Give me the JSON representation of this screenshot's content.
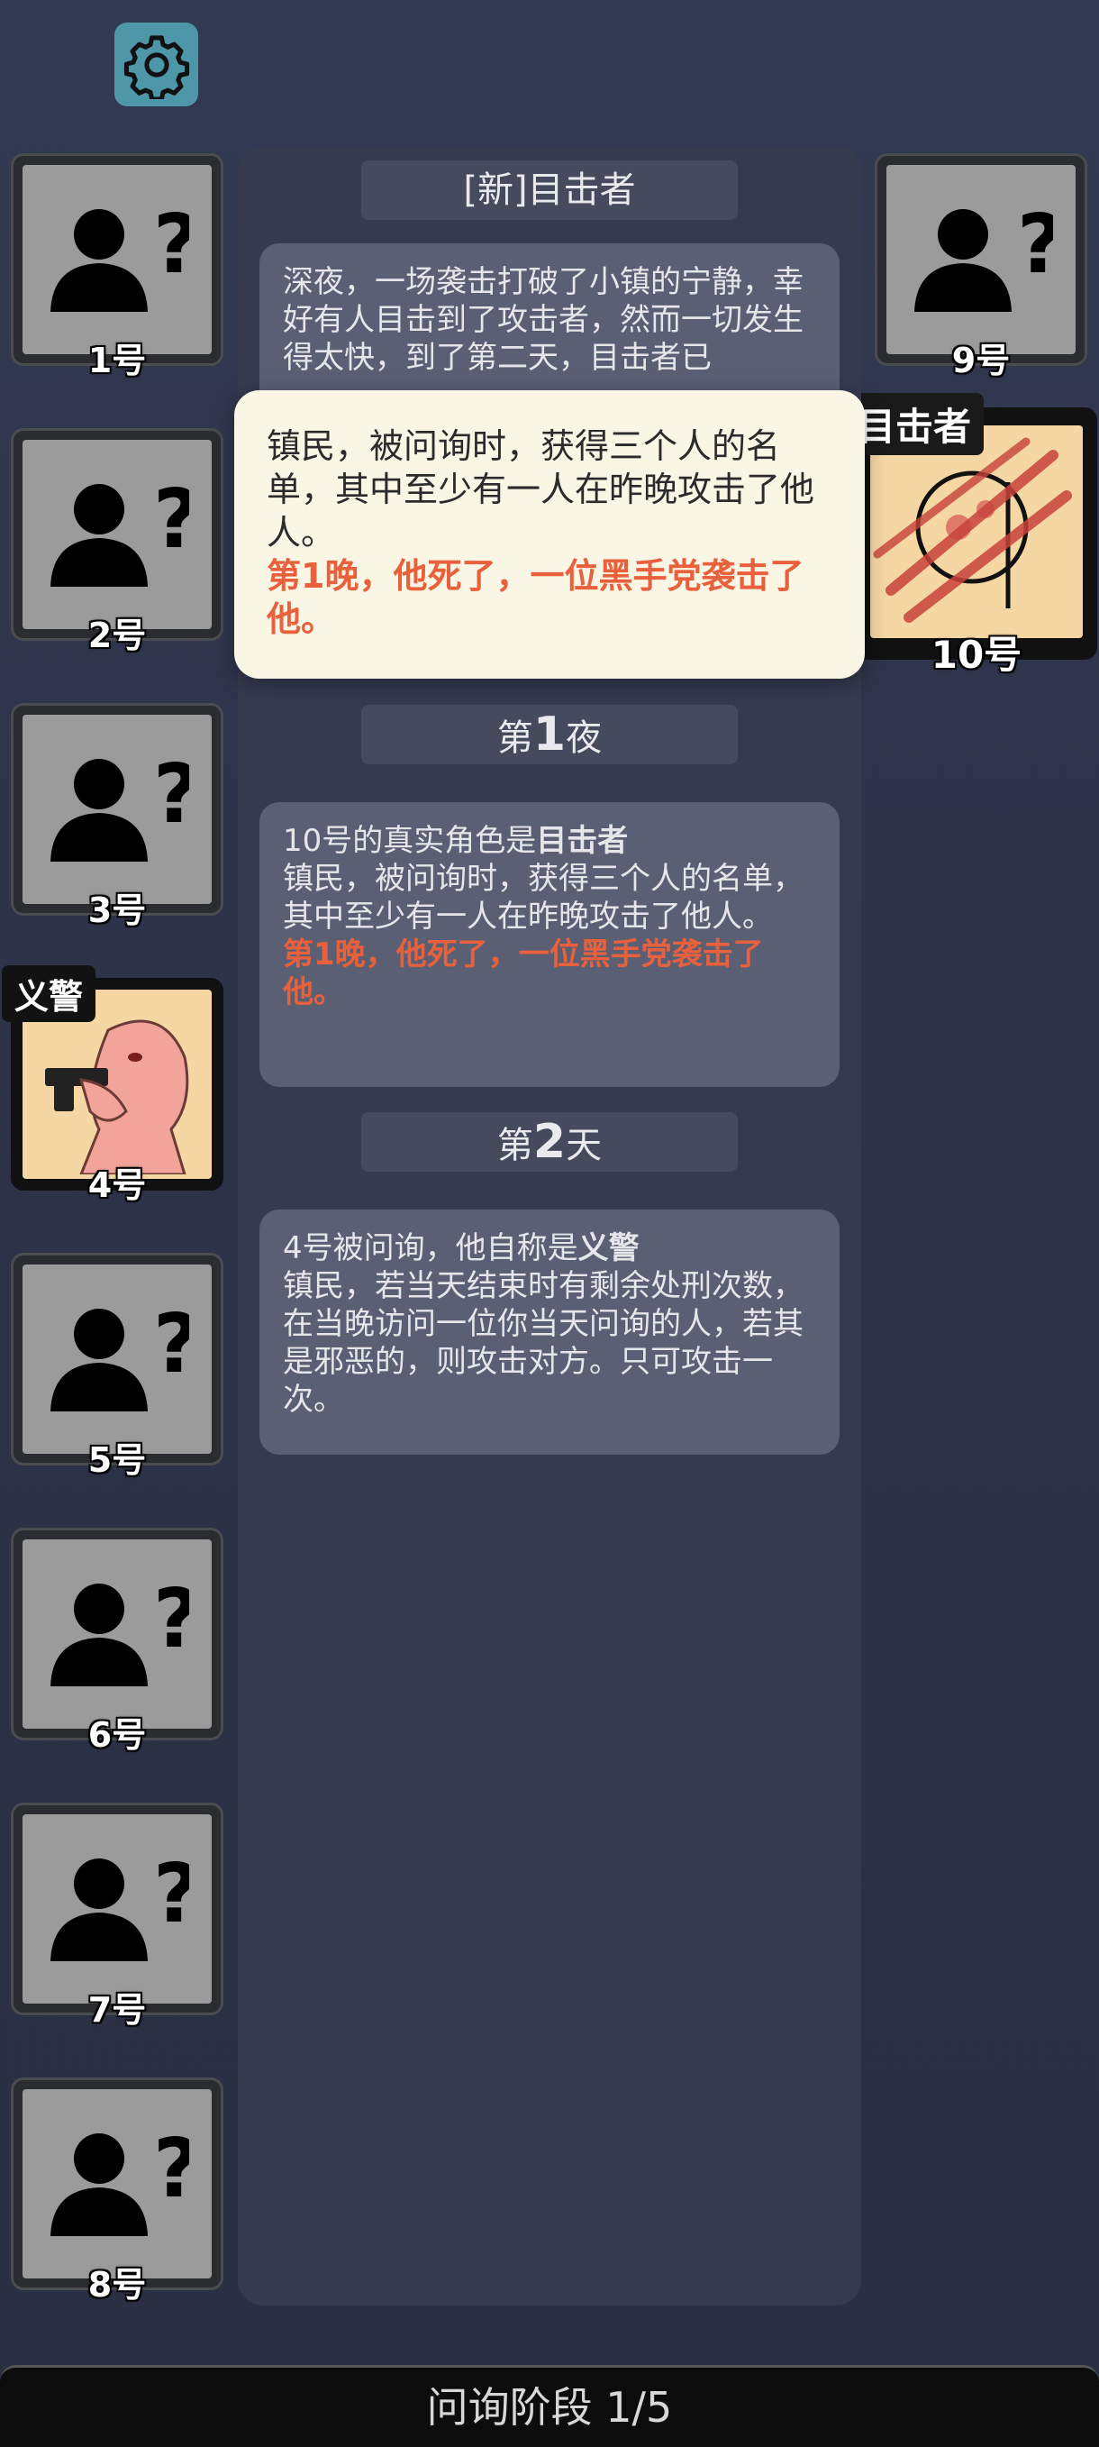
{
  "players": [
    {
      "number": "1号"
    },
    {
      "number": "2号"
    },
    {
      "number": "3号"
    },
    {
      "number": "4号",
      "role_tag": "义警"
    },
    {
      "number": "5号"
    },
    {
      "number": "6号"
    },
    {
      "number": "7号"
    },
    {
      "number": "8号"
    },
    {
      "number": "9号"
    },
    {
      "number": "10号",
      "role_tag": "目击者"
    }
  ],
  "log": {
    "intro_header": "[新]目击者",
    "intro_text": "深夜，一场袭击打破了小镇的宁静，幸好有人目击到了攻击者，然而一切发生得太快，到了第二天，目击者已",
    "night1_header_prefix": "第",
    "night1_header_num": "1",
    "night1_header_suffix": "夜",
    "night1_line1_pre": "10号的真实角色是",
    "night1_line1_bold": "目击者",
    "night1_desc": "镇民，被问询时，获得三个人的名单，其中至少有一人在昨晚攻击了他人。",
    "night1_red": "第1晚，他死了，一位黑手党袭击了他。",
    "day2_header_prefix": "第",
    "day2_header_num": "2",
    "day2_header_suffix": "天",
    "day2_line1_pre": "4号被问询，他自称是",
    "day2_line1_bold": "义警",
    "day2_desc": "镇民，若当天结束时有剩余处刑次数，在当晚访问一位你当天问询的人，若其是邪恶的，则攻击对方。只可攻击一次。"
  },
  "popup": {
    "desc": "镇民，被问询时，获得三个人的名单，其中至少有一人在昨晚攻击了他人。",
    "red": "第1晚，他死了，一位黑手党袭击了他。"
  },
  "phase_label": "问询阶段 1/5",
  "colors": {
    "accent_red": "#e8613c",
    "settings_teal": "#4e97a9",
    "revealed_card": "#f5d7a4"
  }
}
